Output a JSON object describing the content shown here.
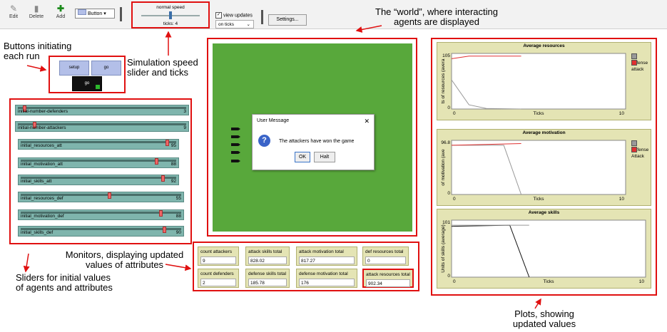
{
  "toolbar": {
    "edit": "Edit",
    "delete": "Delete",
    "add": "Add",
    "widget_type": "Button",
    "speed_label": "normal speed",
    "ticks": "ticks: 4",
    "view_updates": "view updates",
    "update_mode": "on ticks",
    "settings": "Settings..."
  },
  "annotations": {
    "world": "The “world”, where interacting\nagents are displayed",
    "buttons": "Buttons initiating\neach run",
    "speed": "Simulation speed\nslider and ticks",
    "monitors": "Monitors, displaying updated\nvalues of attributes",
    "sliders": "Sliders for initial values\nof agents and attributes",
    "plots": "Plots, showing\nupdated values"
  },
  "buttons": {
    "setup": "setup",
    "go": "go",
    "go_forever": "go"
  },
  "sliders": [
    {
      "label": "initial-number-defenders",
      "value": "3",
      "level": 0.03
    },
    {
      "label": "initial-number-attackers",
      "value": "9",
      "level": 0.09
    },
    {
      "label": "initial_resources_att",
      "value": "95",
      "level": 0.95
    },
    {
      "label": "initial_motivation_att",
      "value": "88",
      "level": 0.88
    },
    {
      "label": "initial_skills_att",
      "value": "92",
      "level": 0.92
    },
    {
      "label": "initial_resources_def",
      "value": "55",
      "level": 0.55
    },
    {
      "label": "initial_motivation_def",
      "value": "88",
      "level": 0.88
    },
    {
      "label": "initial_skills_def",
      "value": "90",
      "level": 0.9
    }
  ],
  "dialog": {
    "title": "User Message",
    "close": "✕",
    "icon": "?",
    "message": "The attackers have won the game",
    "ok": "OK",
    "halt": "Halt"
  },
  "monitors": [
    {
      "label": "count attackers",
      "value": "9"
    },
    {
      "label": "attack skills total",
      "value": "828.02"
    },
    {
      "label": "attack motivation total",
      "value": "817.27"
    },
    {
      "label": "def resources total",
      "value": "0"
    },
    {
      "label": "count defenders",
      "value": "2"
    },
    {
      "label": "defense skills total",
      "value": "185.78"
    },
    {
      "label": "defense motivation total",
      "value": "176"
    },
    {
      "label": "attack resources total",
      "value": "902.34"
    }
  ],
  "plots": [
    {
      "title": "Average resources",
      "ylabel": "ts of resources (avera",
      "xlabel": "Ticks",
      "ymax": "105",
      "ymin": "0",
      "xmin": "0",
      "xmax": "10",
      "legend": [
        "defense",
        "attack"
      ]
    },
    {
      "title": "Average motivation",
      "ylabel": "of motivation (ave",
      "xlabel": "Ticks",
      "ymax": "96.8",
      "ymin": "0",
      "xmin": "0",
      "xmax": "10",
      "legend": [
        "Defense",
        "Attack"
      ]
    },
    {
      "title": "Average skills",
      "ylabel": "Units of skills (average)",
      "xlabel": "Ticks",
      "ymax": "101",
      "ymin": "0",
      "xmin": "0",
      "xmax": "10",
      "legend": []
    }
  ],
  "chart_data": [
    {
      "type": "line",
      "title": "Average resources",
      "xlabel": "Ticks",
      "ylabel": "ts of resources (avera",
      "xlim": [
        0,
        10
      ],
      "ylim": [
        0,
        105
      ],
      "series": [
        {
          "name": "defense",
          "x": [
            0,
            1,
            2,
            4
          ],
          "y": [
            55,
            8,
            1,
            0
          ]
        },
        {
          "name": "attack",
          "x": [
            0,
            1,
            4
          ],
          "y": [
            95,
            100,
            100
          ]
        }
      ]
    },
    {
      "type": "line",
      "title": "Average motivation",
      "xlabel": "Ticks",
      "ylabel": "of motivation (ave",
      "xlim": [
        0,
        10
      ],
      "ylim": [
        0,
        96.8
      ],
      "series": [
        {
          "name": "Defense",
          "x": [
            0,
            3,
            4
          ],
          "y": [
            88,
            88,
            0
          ]
        },
        {
          "name": "Attack",
          "x": [
            0,
            4
          ],
          "y": [
            88,
            91
          ]
        }
      ]
    },
    {
      "type": "line",
      "title": "Average skills",
      "xlabel": "Ticks",
      "ylabel": "Units of skills (average)",
      "xlim": [
        0,
        10
      ],
      "ylim": [
        0,
        101
      ],
      "series": [
        {
          "x": [
            0,
            3,
            4
          ],
          "y": [
            90,
            92,
            0
          ]
        },
        {
          "x": [
            0,
            4
          ],
          "y": [
            92,
            92
          ]
        }
      ]
    }
  ],
  "colors": {
    "defense": "#999999",
    "attack": "#e03030",
    "red": "#e01010",
    "world": "#58a83b"
  }
}
